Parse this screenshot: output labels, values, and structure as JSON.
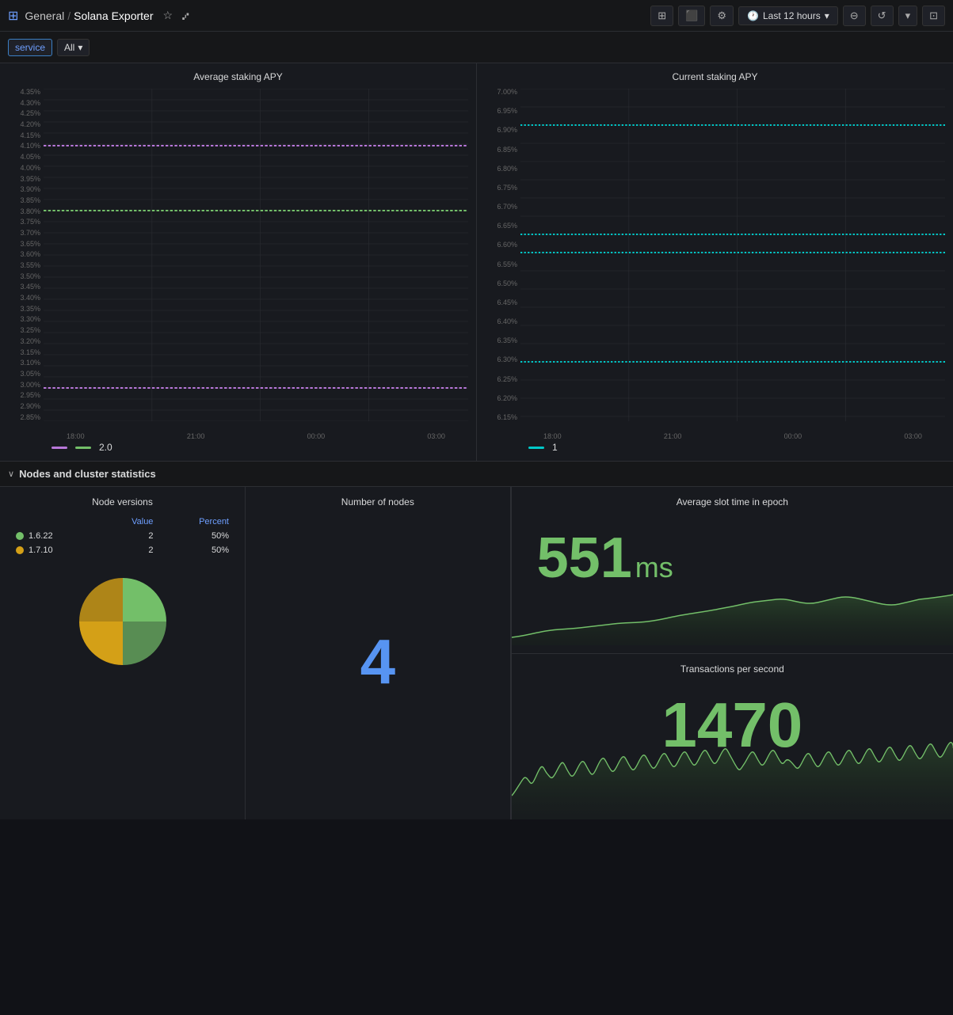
{
  "nav": {
    "app_icon": "⊞",
    "breadcrumb_parent": "General",
    "separator": "/",
    "breadcrumb_current": "Solana Exporter",
    "star_icon": "☆",
    "share_icon": "⑆"
  },
  "toolbar": {
    "add_panel_icon": "📊",
    "dashboard_icon": "⊡",
    "settings_icon": "⚙",
    "time_icon": "🕐",
    "time_label": "Last 12 hours",
    "zoom_out_icon": "🔍",
    "refresh_icon": "↺",
    "refresh_dropdown_icon": "▾",
    "kiosk_icon": "⊡"
  },
  "filter": {
    "label": "service",
    "value": "All",
    "dropdown_icon": "▾"
  },
  "charts": {
    "left": {
      "title": "Average staking APY",
      "y_labels": [
        "4.35%",
        "4.30%",
        "4.25%",
        "4.20%",
        "4.15%",
        "4.10%",
        "4.05%",
        "4.00%",
        "3.95%",
        "3.90%",
        "3.85%",
        "3.80%",
        "3.75%",
        "3.70%",
        "3.65%",
        "3.60%",
        "3.55%",
        "3.50%",
        "3.45%",
        "3.40%",
        "3.35%",
        "3.30%",
        "3.25%",
        "3.20%",
        "3.15%",
        "3.10%",
        "3.05%",
        "3.00%",
        "2.95%",
        "2.90%",
        "2.85%"
      ],
      "x_labels": [
        "18:00",
        "21:00",
        "00:00",
        "03:00"
      ],
      "lines": [
        {
          "color": "#b877d9",
          "y_position": 0.83,
          "label": ""
        },
        {
          "color": "#73bf69",
          "y_position": 0.585,
          "label": ""
        },
        {
          "color": "#b877d9",
          "y_position": 0.095,
          "label": ""
        }
      ],
      "legend_value": "2.0"
    },
    "right": {
      "title": "Current staking APY",
      "y_labels": [
        "7.00%",
        "6.95%",
        "6.90%",
        "6.85%",
        "6.80%",
        "6.75%",
        "6.70%",
        "6.65%",
        "6.60%",
        "6.55%",
        "6.50%",
        "6.45%",
        "6.40%",
        "6.35%",
        "6.30%",
        "6.25%",
        "6.20%",
        "6.15%"
      ],
      "x_labels": [
        "18:00",
        "21:00",
        "00:00",
        "03:00"
      ],
      "lines": [
        {
          "color": "#00c8c8",
          "y_position": 0.12,
          "label": ""
        },
        {
          "color": "#00c8c8",
          "y_position": 0.56,
          "label": ""
        },
        {
          "color": "#00c8c8",
          "y_position": 0.62,
          "label": ""
        },
        {
          "color": "#00c8c8",
          "y_position": 0.895,
          "label": ""
        }
      ],
      "legend_value": "1"
    }
  },
  "section": {
    "title": "Nodes and cluster statistics",
    "chevron": "∨"
  },
  "node_versions": {
    "panel_title": "Node versions",
    "col_value": "Value",
    "col_percent": "Percent",
    "rows": [
      {
        "version": "1.6.22",
        "color": "#73bf69",
        "value": 2,
        "percent": "50%"
      },
      {
        "version": "1.7.10",
        "color": "#d4a017",
        "value": 2,
        "percent": "50%"
      }
    ]
  },
  "number_of_nodes": {
    "panel_title": "Number of nodes",
    "value": "4"
  },
  "slot_time": {
    "panel_title": "Average slot time in epoch",
    "value": "551",
    "unit": "ms"
  },
  "tps": {
    "panel_title": "Transactions per second",
    "value": "1470"
  }
}
